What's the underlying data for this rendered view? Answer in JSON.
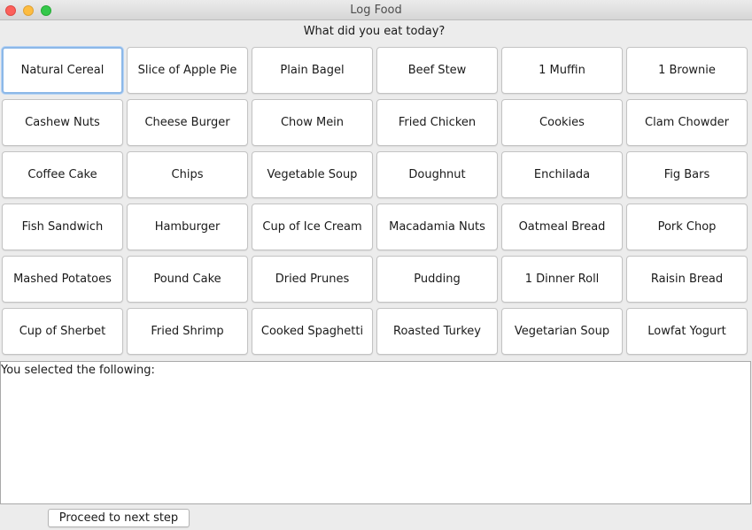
{
  "window": {
    "title": "Log Food"
  },
  "prompt": "What did you eat today?",
  "food_buttons": [
    "Natural Cereal",
    "Slice of Apple Pie",
    "Plain Bagel",
    "Beef Stew",
    "1 Muffin",
    "1 Brownie",
    "Cashew Nuts",
    "Cheese Burger",
    "Chow Mein",
    "Fried Chicken",
    "Cookies",
    "Clam Chowder",
    "Coffee Cake",
    "Chips",
    "Vegetable Soup",
    "Doughnut",
    "Enchilada",
    "Fig Bars",
    "Fish Sandwich",
    "Hamburger",
    "Cup of Ice Cream",
    "Macadamia Nuts",
    "Oatmeal Bread",
    "Pork Chop",
    "Mashed Potatoes",
    "Pound Cake",
    "Dried Prunes",
    "Pudding",
    "1 Dinner Roll",
    "Raisin Bread",
    "Cup of Sherbet",
    "Fried Shrimp",
    "Cooked Spaghetti",
    "Roasted Turkey",
    "Vegetarian Soup",
    "Lowfat Yogurt"
  ],
  "focused_button": "Natural Cereal",
  "selection": {
    "label": "You selected the following:"
  },
  "actions": {
    "proceed_label": "Proceed to next step"
  },
  "colors": {
    "close": "#fc605b",
    "minimize": "#fdbc40",
    "maximize": "#34c84a",
    "focus_ring": "#8cb8e8"
  }
}
